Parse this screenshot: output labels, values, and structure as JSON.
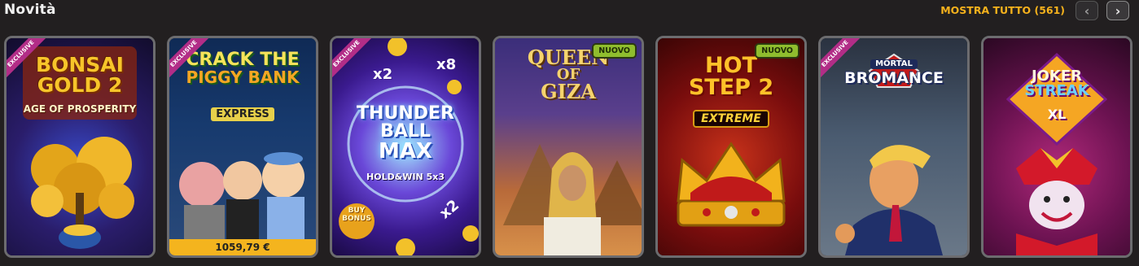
{
  "section": {
    "title": "Novità",
    "show_all": "MOSTRA TUTTO (561)",
    "prev_icon": "chevron-left-icon",
    "next_icon": "chevron-right-icon"
  },
  "colors": {
    "background": "#221f20",
    "accent": "#f7b21c",
    "exclusive_ribbon": "#b22d87",
    "new_badge": "#8fbd2e"
  },
  "games": [
    {
      "title_lines": [
        "BONSAI",
        "GOLD 2"
      ],
      "subtitle": "AGE OF PROSPERITY",
      "ribbon": "EXCLUSIVE"
    },
    {
      "title_lines": [
        "CRACK THE",
        "PIGGY BANK"
      ],
      "subtitle": "EXPRESS",
      "ribbon": "EXCLUSIVE",
      "jackpot": "1059,79 €"
    },
    {
      "title_lines": [
        "THUNDER",
        "BALL",
        "MAX"
      ],
      "subtitle": "HOLD&WIN 5x3",
      "ribbon": "EXCLUSIVE",
      "extras": [
        "x2",
        "x8",
        "x2",
        "BUY BONUS"
      ]
    },
    {
      "title_lines": [
        "QUEEN",
        "OF",
        "GIZA"
      ],
      "badge": "NUOVO"
    },
    {
      "title_lines": [
        "HOT",
        "STEP 2"
      ],
      "subtitle": "EXTREME",
      "badge": "NUOVO"
    },
    {
      "title_lines": [
        "MORTAL",
        "BROMANCE"
      ],
      "ribbon": "EXCLUSIVE"
    },
    {
      "title_lines": [
        "JOKER",
        "STREAK"
      ],
      "subtitle": "XL"
    }
  ]
}
